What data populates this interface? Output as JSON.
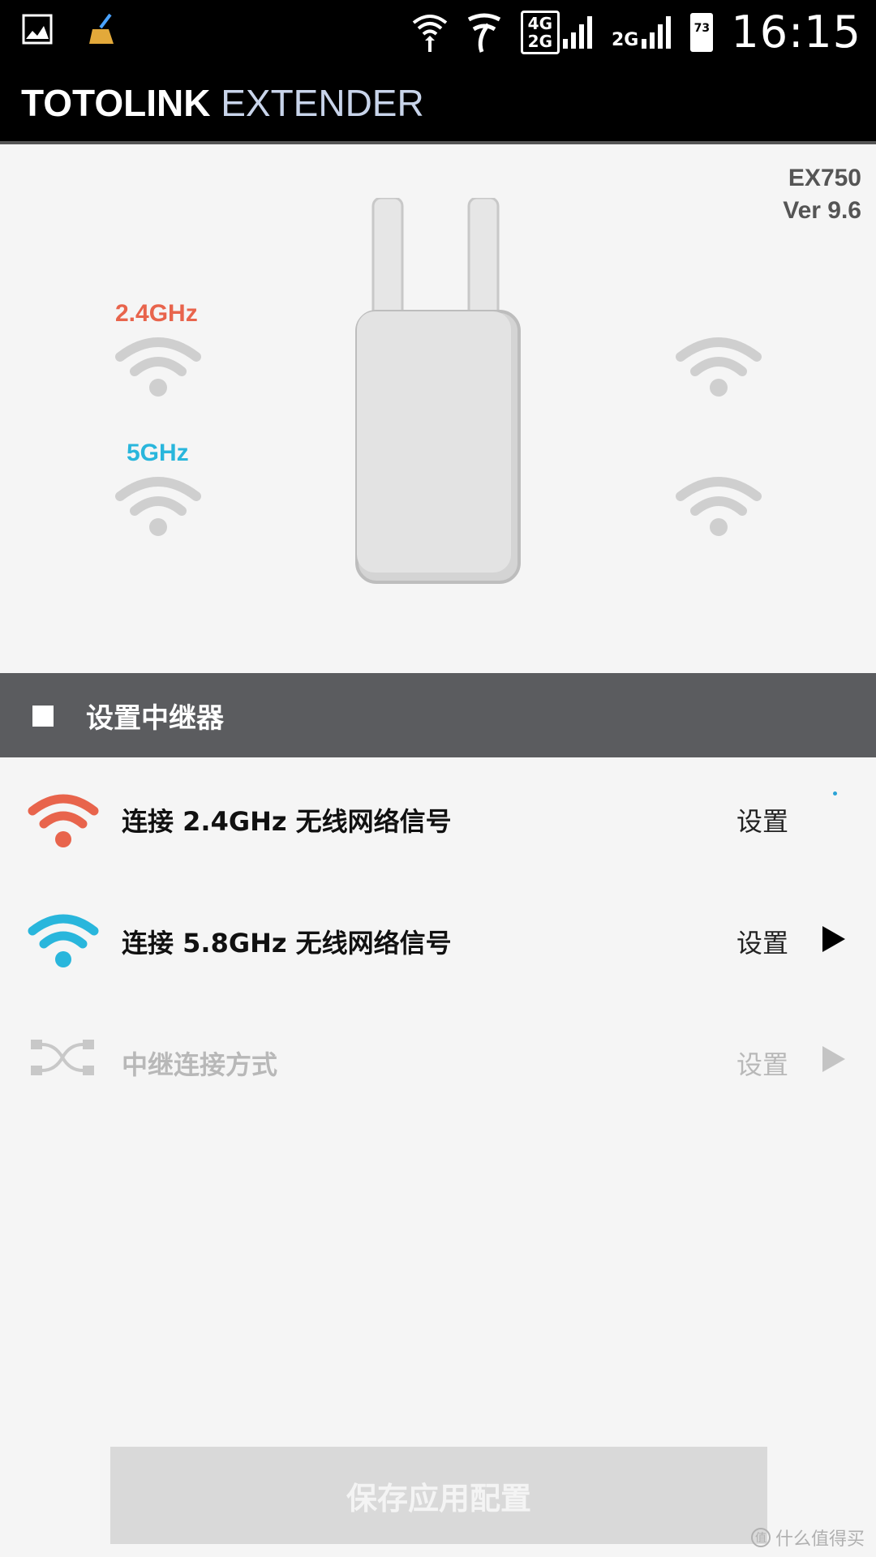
{
  "status_bar": {
    "time": "16:15",
    "network_4g": "4G",
    "network_2g": "2G",
    "network_2g_b": "2G",
    "battery": "73",
    "icons": [
      "image-icon",
      "cleaner-broom-icon",
      "wifi-icon",
      "telecom-icon",
      "signal-icon",
      "battery-icon"
    ]
  },
  "header": {
    "title_bold": "TOTOLINK",
    "title_light": "EXTENDER"
  },
  "device": {
    "model": "EX750",
    "version": "Ver 9.6",
    "band_24_label": "2.4GHz",
    "band_5_label": "5GHz",
    "colors": {
      "band_24": "#e8644c",
      "band_5": "#29b6dc",
      "inactive": "#cfcfcf"
    }
  },
  "section": {
    "title": "设置中继器"
  },
  "rows": [
    {
      "label": "连接 2.4GHz 无线网络信号",
      "action": "设置",
      "icon": "wifi-red-icon",
      "enabled": true
    },
    {
      "label": "连接 5.8GHz 无线网络信号",
      "action": "设置",
      "icon": "wifi-blue-icon",
      "enabled": true
    },
    {
      "label": "中继连接方式",
      "action": "设置",
      "icon": "shuffle-icon",
      "enabled": false
    }
  ],
  "save_button": {
    "label": "保存应用配置"
  },
  "watermark": {
    "icon_text": "值",
    "text": "什么值得买"
  }
}
